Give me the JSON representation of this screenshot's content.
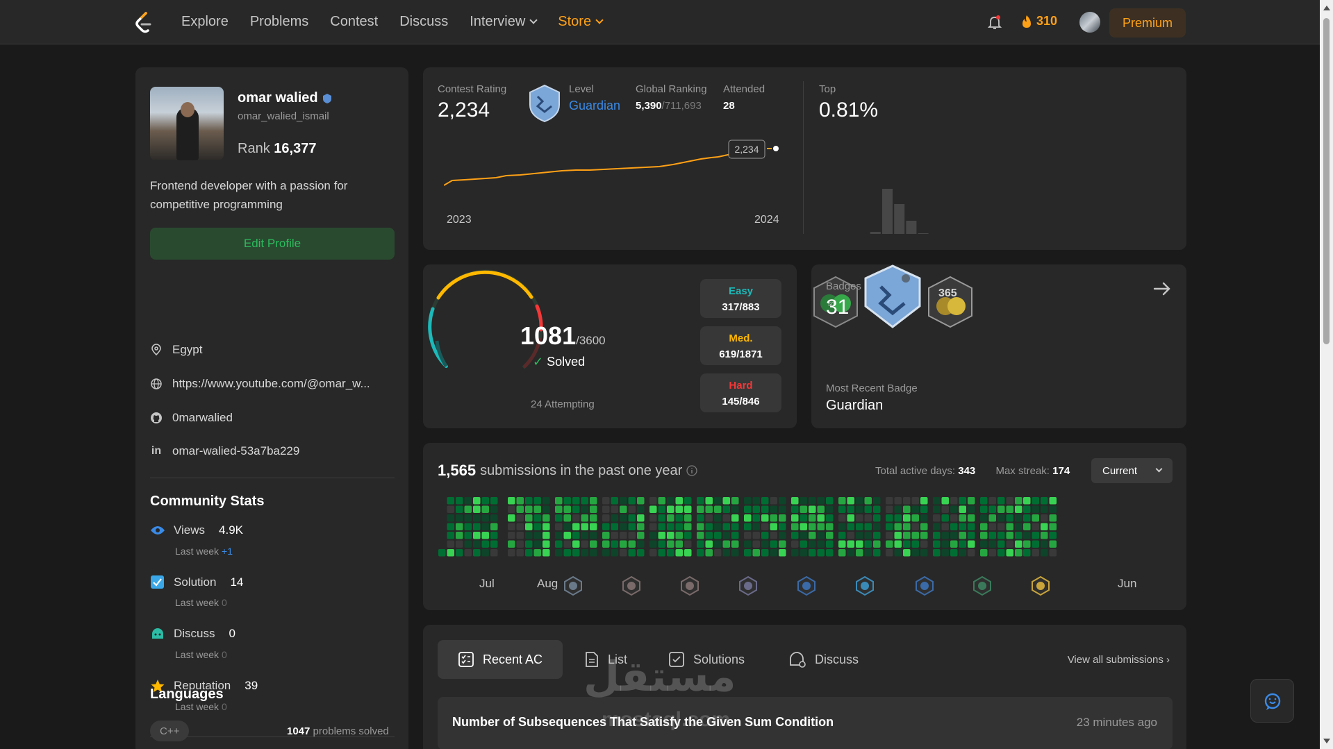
{
  "nav": {
    "links": [
      "Explore",
      "Problems",
      "Contest",
      "Discuss",
      "Interview",
      "Store"
    ],
    "streak": "310",
    "premium": "Premium"
  },
  "profile": {
    "name": "omar walied",
    "username": "omar_walied_ismail",
    "rank_label": "Rank",
    "rank": "16,377",
    "bio": "Frontend developer with a passion for competitive programming",
    "edit": "Edit Profile",
    "location": "Egypt",
    "website": "https://www.youtube.com/@omar_w...",
    "github": "0marwalied",
    "linkedin": "omar-walied-53a7ba229",
    "community_title": "Community Stats",
    "stats": [
      {
        "label": "Views",
        "value": "4.9K",
        "lastweek": "Last week",
        "delta": "+1",
        "icon": "eye-icon",
        "color": "#3a8be8"
      },
      {
        "label": "Solution",
        "value": "14",
        "lastweek": "Last week",
        "delta": "0",
        "icon": "check-square-icon",
        "color": "#3aa7e8"
      },
      {
        "label": "Discuss",
        "value": "0",
        "lastweek": "Last week",
        "delta": "0",
        "icon": "chat-icon",
        "color": "#2cbba5"
      },
      {
        "label": "Reputation",
        "value": "39",
        "lastweek": "Last week",
        "delta": "0",
        "icon": "star-icon",
        "color": "#ffb800"
      }
    ],
    "languages_title": "Languages",
    "language": "C++",
    "language_solved": "1047",
    "language_solved_suffix": "problems solved"
  },
  "contest": {
    "rating_label": "Contest Rating",
    "rating": "2,234",
    "level_label": "Level",
    "level": "Guardian",
    "ranking_label": "Global Ranking",
    "ranking": "5,390",
    "ranking_total": "/711,693",
    "attended_label": "Attended",
    "attended": "28",
    "tooltip": "2,234",
    "x_start": "2023",
    "x_end": "2024",
    "top_label": "Top",
    "top_value": "0.81%",
    "accent": "#ffa116"
  },
  "problems": {
    "solved": "1081",
    "total": "/3600",
    "solved_label": "Solved",
    "attempting": "24 Attempting",
    "easy_label": "Easy",
    "easy": "317/883",
    "easy_color": "#1cbaba",
    "med_label": "Med.",
    "med": "619/1871",
    "med_color": "#ffb800",
    "hard_label": "Hard",
    "hard": "145/846",
    "hard_color": "#f63737"
  },
  "badges": {
    "label": "Badges",
    "count": "31",
    "recent_label": "Most Recent Badge",
    "recent": "Guardian"
  },
  "submissions": {
    "count": "1,565",
    "text": "submissions in the past one year",
    "active_label": "Total active days:",
    "active": "343",
    "streak_label": "Max streak:",
    "streak": "174",
    "select": "Current",
    "months": [
      "Jul",
      "Aug",
      "Jun"
    ]
  },
  "tabs": {
    "items": [
      "Recent AC",
      "List",
      "Solutions",
      "Discuss"
    ],
    "view_all": "View all submissions",
    "row_title": "Number of Subsequences That Satisfy the Given Sum Condition",
    "row_time": "23 minutes ago"
  },
  "watermark": "مستقل",
  "watermark_sub": "mostaql.com"
}
